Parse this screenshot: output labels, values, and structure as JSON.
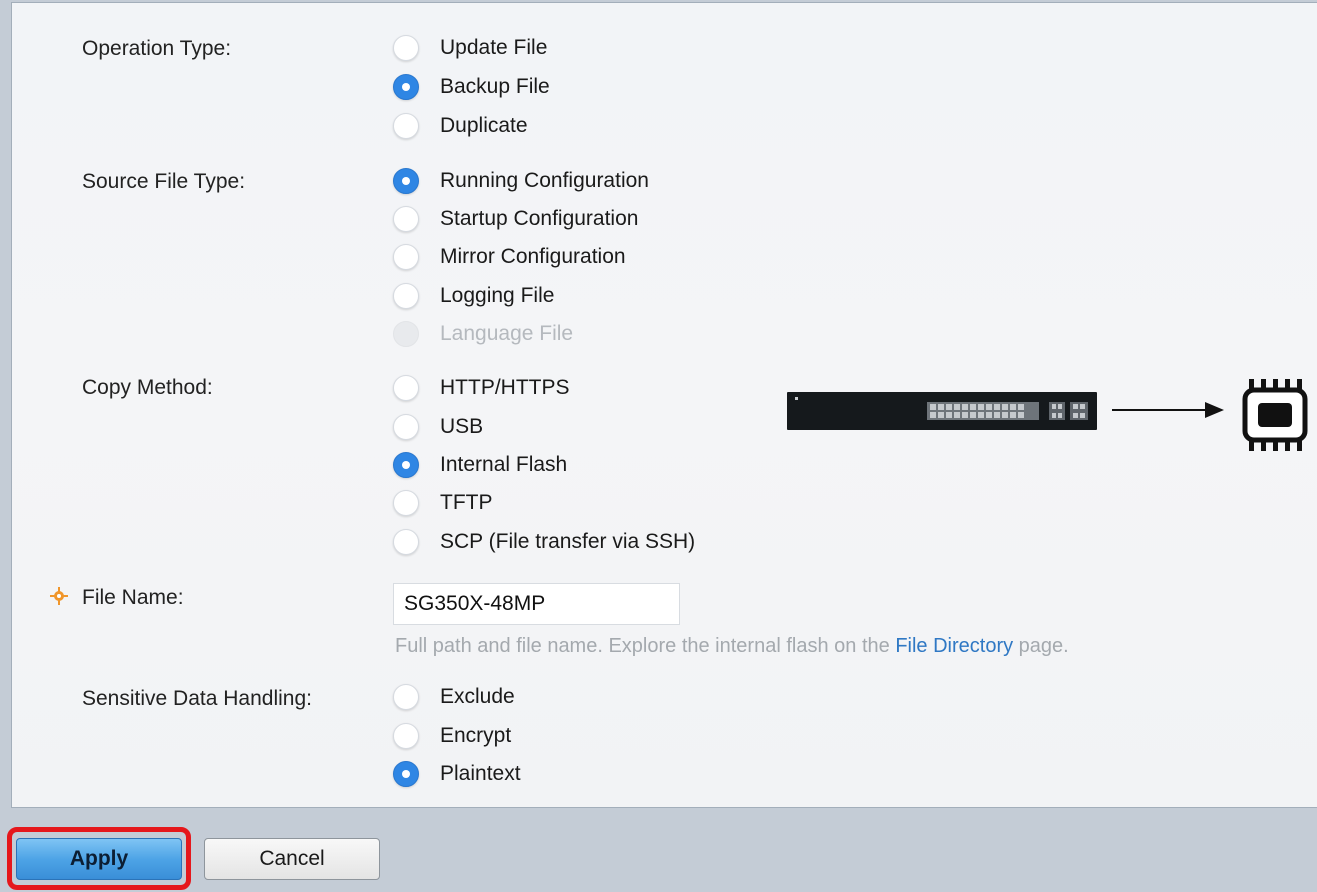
{
  "operation_type": {
    "label": "Operation Type:",
    "options": [
      {
        "label": "Update File",
        "checked": false
      },
      {
        "label": "Backup File",
        "checked": true
      },
      {
        "label": "Duplicate",
        "checked": false
      }
    ]
  },
  "source_file_type": {
    "label": "Source File Type:",
    "options": [
      {
        "label": "Running Configuration",
        "checked": true
      },
      {
        "label": "Startup Configuration",
        "checked": false
      },
      {
        "label": "Mirror Configuration",
        "checked": false
      },
      {
        "label": "Logging File",
        "checked": false
      },
      {
        "label": "Language File",
        "checked": false,
        "disabled": true
      }
    ]
  },
  "copy_method": {
    "label": "Copy Method:",
    "options": [
      {
        "label": "HTTP/HTTPS",
        "checked": false
      },
      {
        "label": "USB",
        "checked": false
      },
      {
        "label": "Internal Flash",
        "checked": true
      },
      {
        "label": "TFTP",
        "checked": false
      },
      {
        "label": "SCP (File transfer via SSH)",
        "checked": false
      }
    ]
  },
  "file_name": {
    "label": "File Name:",
    "value": "SG350X-48MP",
    "hint_prefix": "Full path and file name. Explore the internal flash on the ",
    "hint_link": "File Directory",
    "hint_suffix": " page."
  },
  "sensitive_data": {
    "label": "Sensitive Data Handling:",
    "options": [
      {
        "label": "Exclude",
        "checked": false
      },
      {
        "label": "Encrypt",
        "checked": false
      },
      {
        "label": "Plaintext",
        "checked": true
      }
    ]
  },
  "buttons": {
    "apply": "Apply",
    "cancel": "Cancel"
  },
  "diagram": {
    "source_icon": "network-switch-icon",
    "arrow_icon": "right-arrow-icon",
    "target_icon": "flash-memory-chip-icon"
  },
  "colors": {
    "radio_checked": "#2f86e4",
    "link": "#2f78c4",
    "apply_button": "#4ea4e6",
    "highlight": "#e5171c",
    "required_icon": "#f0962b"
  }
}
